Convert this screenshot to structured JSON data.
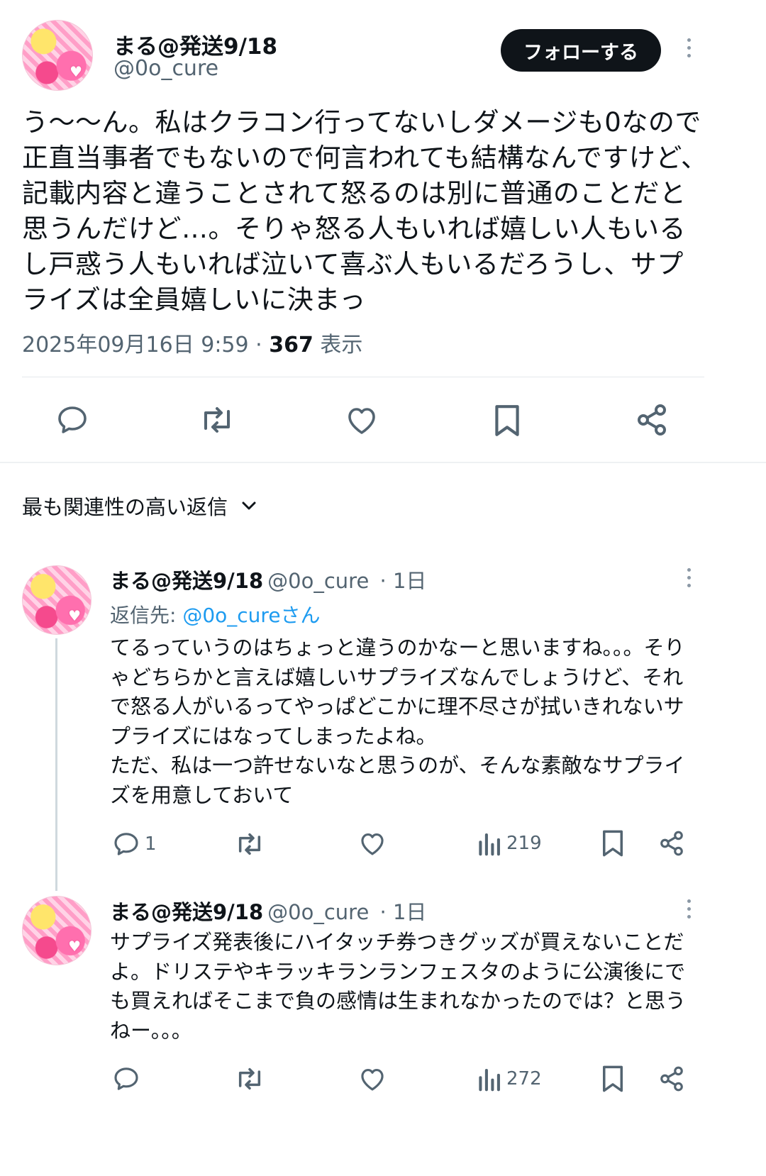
{
  "tweet": {
    "display_name": "まる@発送9/18",
    "handle": "@0o_cure",
    "follow_label": "フォローする",
    "text": "う〜〜ん。私はクラコン行ってないしダメージも0なので正直当事者でもないので何言われても結構なんですけど、記載内容と違うことされて怒るのは別に普通のことだと思うんだけど…。そりゃ怒る人もいれば嬉しい人もいるし戸惑う人もいれば泣いて喜ぶ人もいるだろうし、サプライズは全員嬉しいに決まっ",
    "timestamp": "2025年09月16日 9:59",
    "separator": " · ",
    "views_count": "367",
    "views_label": " 表示"
  },
  "actions": {
    "reply_icon": "reply-icon",
    "retweet_icon": "retweet-icon",
    "like_icon": "like-icon",
    "bookmark_icon": "bookmark-icon",
    "share_icon": "share-icon"
  },
  "replies_section": {
    "sort_label": "最も関連性の高い返信"
  },
  "replies": [
    {
      "display_name": "まる@発送9/18",
      "handle": "@0o_cure",
      "time": "· 1日",
      "reply_to_prefix": "返信先: ",
      "reply_to_handle": "@0o_cureさん",
      "text": "てるっていうのはちょっと違うのかなーと思いますね。。。そりゃどちらかと言えば嬉しいサプライズなんでしょうけど、それで怒る人がいるってやっぱどこかに理不尽さが拭いきれないサプライズにはなってしまったよね。\nただ、私は一つ許せないなと思うのが、そんな素敵なサプライズを用意しておいて",
      "reply_count": "1",
      "views": "219"
    },
    {
      "display_name": "まる@発送9/18",
      "handle": "@0o_cure",
      "time": "· 1日",
      "text": "サプライズ発表後にハイタッチ券つきグッズが買えないことだよ。ドリステやキラッキランランフェスタのように公演後にでも買えればそこまで負の感情は生まれなかったのでは？と思うねー。。。",
      "reply_count": "",
      "views": "272"
    }
  ],
  "colors": {
    "text": "#0f1419",
    "secondary": "#536471",
    "link": "#1d9bf0",
    "button_bg": "#0f1419",
    "divider": "#e4e9ec"
  }
}
